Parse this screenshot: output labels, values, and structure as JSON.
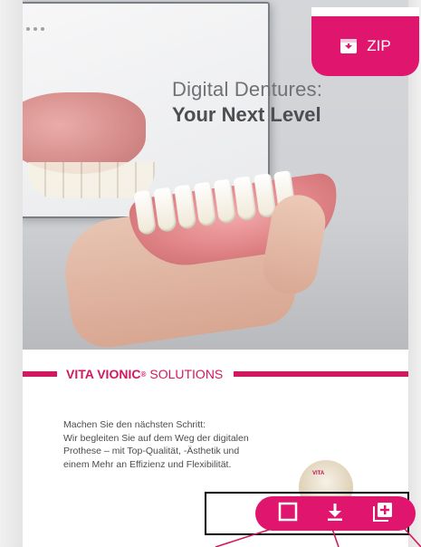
{
  "hero": {
    "headline_line1": "Digital Dentures:",
    "headline_line2": "Your Next Level"
  },
  "zip_button": {
    "label": "ZIP",
    "icon": "archive-download-icon"
  },
  "brand_bar": {
    "brand_bold": "VITA VIONIC",
    "registered": "®",
    "brand_thin": "SOLUTIONS"
  },
  "body": {
    "lines": [
      "Machen Sie den nächsten Schritt:",
      "Wir begleiten Sie auf dem Weg der digitalen",
      "Prothese – mit Top-Qualität, -Ästhetik und",
      "einem Mehr an Effizienz und Flexibilität."
    ]
  },
  "product": {
    "label": "VITA"
  },
  "toolbar": {
    "icons": [
      "select-square-icon",
      "download-icon",
      "add-to-collection-icon"
    ]
  },
  "colors": {
    "accent": "#e0166e",
    "brand": "#d1195f",
    "frame": "#000000"
  }
}
